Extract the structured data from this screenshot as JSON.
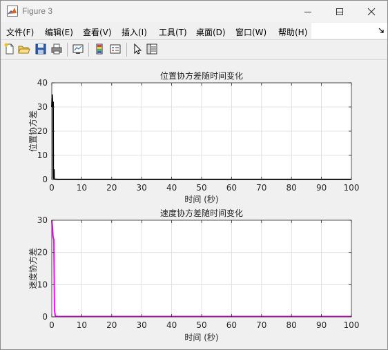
{
  "window": {
    "title": "Figure 3"
  },
  "menu": [
    "文件(F)",
    "编辑(E)",
    "查看(V)",
    "插入(I)",
    "工具(T)",
    "桌面(D)",
    "窗口(W)",
    "帮助(H)"
  ],
  "toolbar": [
    "new-figure-icon",
    "open-icon",
    "save-icon",
    "print-icon",
    "link-plot-icon",
    "insert-colorbar-icon",
    "insert-legend-icon",
    "edit-plot-icon",
    "property-inspector-icon"
  ],
  "chart_data": [
    {
      "type": "line",
      "title": "位置协方差随时间变化",
      "xlabel": "时间 (秒)",
      "ylabel": "位置协方差",
      "xlim": [
        0,
        100
      ],
      "ylim": [
        0,
        40
      ],
      "xticks": [
        "0",
        "10",
        "20",
        "30",
        "40",
        "50",
        "60",
        "70",
        "80",
        "90",
        "100"
      ],
      "yticks": [
        "0",
        "10",
        "20",
        "30",
        "40"
      ],
      "grid": true,
      "series": [
        {
          "color": "#000000",
          "x": [
            0,
            0.15,
            0.3,
            0.45,
            0.5,
            0.55,
            0.7,
            0.75,
            0.8,
            1.0,
            2,
            100
          ],
          "y": [
            30,
            35,
            30,
            32,
            1.5,
            0.5,
            3.5,
            4,
            0.2,
            0.1,
            0.05,
            0.05
          ]
        }
      ]
    },
    {
      "type": "line",
      "title": "速度协方差随时间变化",
      "xlabel": "时间 (秒)",
      "ylabel": "速度协方差",
      "xlim": [
        0,
        100
      ],
      "ylim": [
        0,
        30
      ],
      "xticks": [
        "0",
        "10",
        "20",
        "30",
        "40",
        "50",
        "60",
        "70",
        "80",
        "90",
        "100"
      ],
      "yticks": [
        "0",
        "10",
        "20",
        "30"
      ],
      "grid": true,
      "series": [
        {
          "color": "#ff00ff",
          "x": [
            0,
            0.2,
            0.4,
            0.5,
            0.7,
            0.9,
            1.2,
            2,
            100
          ],
          "y": [
            30,
            28,
            25,
            24.5,
            24,
            2,
            0.2,
            0.1,
            0.1
          ]
        }
      ]
    }
  ]
}
